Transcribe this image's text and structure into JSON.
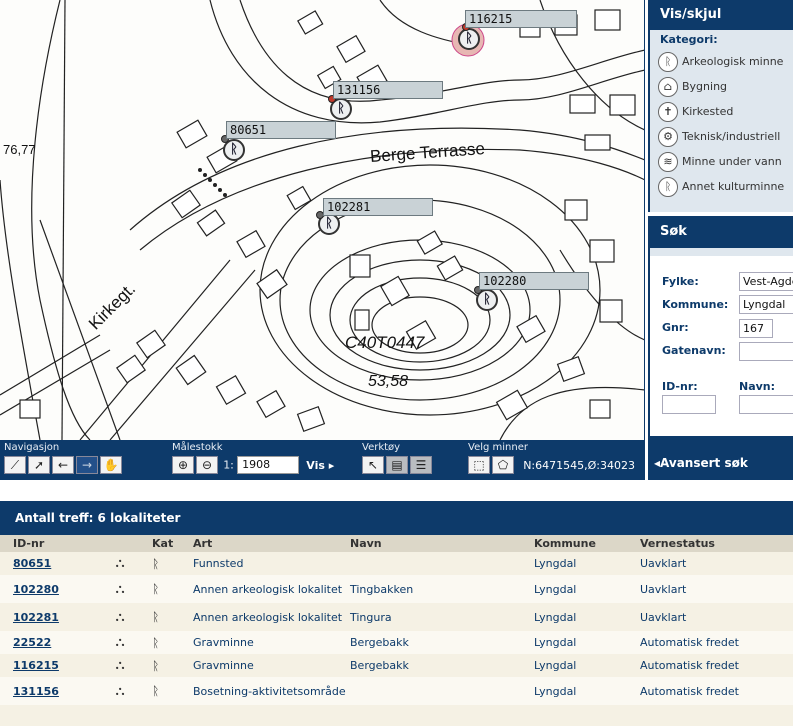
{
  "map": {
    "street_labels": [
      "Berge Terrasse",
      "Kirkegt."
    ],
    "height_labels": [
      "76,77",
      "53,58"
    ],
    "parcel_label": "C40T0447",
    "markers": [
      {
        "id": "116215"
      },
      {
        "id": "131156"
      },
      {
        "id": "80651"
      },
      {
        "id": "102281"
      },
      {
        "id": "102280"
      }
    ]
  },
  "toolbar": {
    "navigasjon_label": "Navigasjon",
    "malestokk_label": "Målestokk",
    "scale_prefix": "1:",
    "scale_value": "1908",
    "vis_label": "Vis",
    "verktoy_label": "Verktøy",
    "velg_label": "Velg minner",
    "coords": "N:6471545,Ø:34023"
  },
  "visskjul": {
    "title": "Vis/skjul",
    "kategori_label": "Kategori:",
    "items": [
      {
        "label": "Arkeologisk minne",
        "icon": "ᚱ"
      },
      {
        "label": "Bygning",
        "icon": "⌂"
      },
      {
        "label": "Kirkested",
        "icon": "✝"
      },
      {
        "label": "Teknisk/industriell",
        "icon": "⚙"
      },
      {
        "label": "Minne under vann",
        "icon": "≋"
      },
      {
        "label": "Annet kulturminne",
        "icon": "ᚱ"
      }
    ]
  },
  "sok": {
    "title": "Søk",
    "fylke_label": "Fylke:",
    "fylke_value": "Vest-Agder",
    "kommune_label": "Kommune:",
    "kommune_value": "Lyngdal",
    "gnr_label": "Gnr:",
    "gnr_value": "167",
    "gatenavn_label": "Gatenavn:",
    "gatenavn_value": "",
    "idnr_label": "ID-nr:",
    "idnr_value": "",
    "navn_label": "Navn:",
    "navn_value": "",
    "avansert_label": "Avansert søk"
  },
  "results": {
    "title": "Antall treff: 6 lokaliteter",
    "columns": [
      "ID-nr",
      "",
      "Kat",
      "Art",
      "Navn",
      "Kommune",
      "Vernestatus"
    ],
    "rows": [
      {
        "id": "80651",
        "kat": "ᚱ",
        "art": "Funnsted",
        "navn": "",
        "kommune": "Lyngdal",
        "vernestatus": "Uavklart"
      },
      {
        "id": "102280",
        "kat": "ᚱ",
        "art": "Annen arkeologisk lokalitet",
        "navn": "Tingbakken",
        "kommune": "Lyngdal",
        "vernestatus": "Uavklart"
      },
      {
        "id": "102281",
        "kat": "ᚱ",
        "art": "Annen arkeologisk lokalitet",
        "navn": "Tingura",
        "kommune": "Lyngdal",
        "vernestatus": "Uavklart"
      },
      {
        "id": "22522",
        "kat": "ᚱ",
        "art": "Gravminne",
        "navn": "Bergebakk",
        "kommune": "Lyngdal",
        "vernestatus": "Automatisk fredet"
      },
      {
        "id": "116215",
        "kat": "ᚱ",
        "art": "Gravminne",
        "navn": "Bergebakk",
        "kommune": "Lyngdal",
        "vernestatus": "Automatisk fredet"
      },
      {
        "id": "131156",
        "kat": "ᚱ",
        "art": "Bosetning-aktivitetsområde",
        "navn": "",
        "kommune": "Lyngdal",
        "vernestatus": "Automatisk fredet"
      }
    ]
  }
}
